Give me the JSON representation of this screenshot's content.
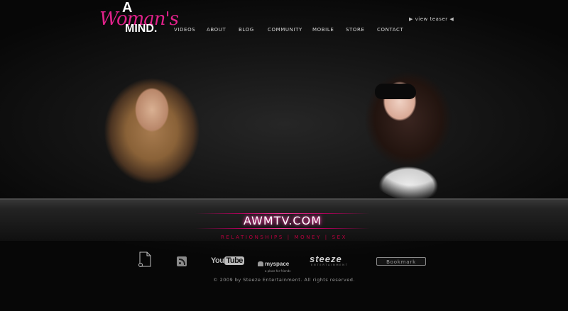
{
  "header": {
    "logo": {
      "a": "A",
      "womans": "Woman's",
      "mind": "MIND.",
      "accent_color": "#e0218a"
    },
    "nav": [
      {
        "label": "VIDEOS"
      },
      {
        "label": "ABOUT"
      },
      {
        "label": "BLOG"
      },
      {
        "label": "COMMUNITY"
      },
      {
        "label": "MOBILE"
      },
      {
        "label": "STORE"
      },
      {
        "label": "CONTACT"
      }
    ],
    "teaser": {
      "label": "view teaser",
      "icon_left": "play-triangle-icon",
      "icon_right": "triangle-left-icon"
    }
  },
  "hero": {
    "photo_left": "woman-blonde-photo",
    "photo_right": "woman-sunglasses-photo"
  },
  "branding": {
    "site_title": "AWMTV.COM",
    "tagline": "RELATIONSHIPS  |  MONEY  |  SEX",
    "tagline_color": "#b8003e",
    "glow_color": "#ff46b0"
  },
  "icons": {
    "doc": "document-icon",
    "rss": "rss-icon",
    "youtube": {
      "you": "You",
      "tube": "Tube"
    },
    "myspace": {
      "label": "myspace",
      "sub": "a place for friends"
    },
    "steeze": {
      "label": "steeze",
      "sub": "ENTERTAINMENT"
    }
  },
  "bookmark": {
    "label": "Bookmark"
  },
  "footer": {
    "copyright": "© 2009 by Steeze Entertainment. All rights reserved."
  }
}
